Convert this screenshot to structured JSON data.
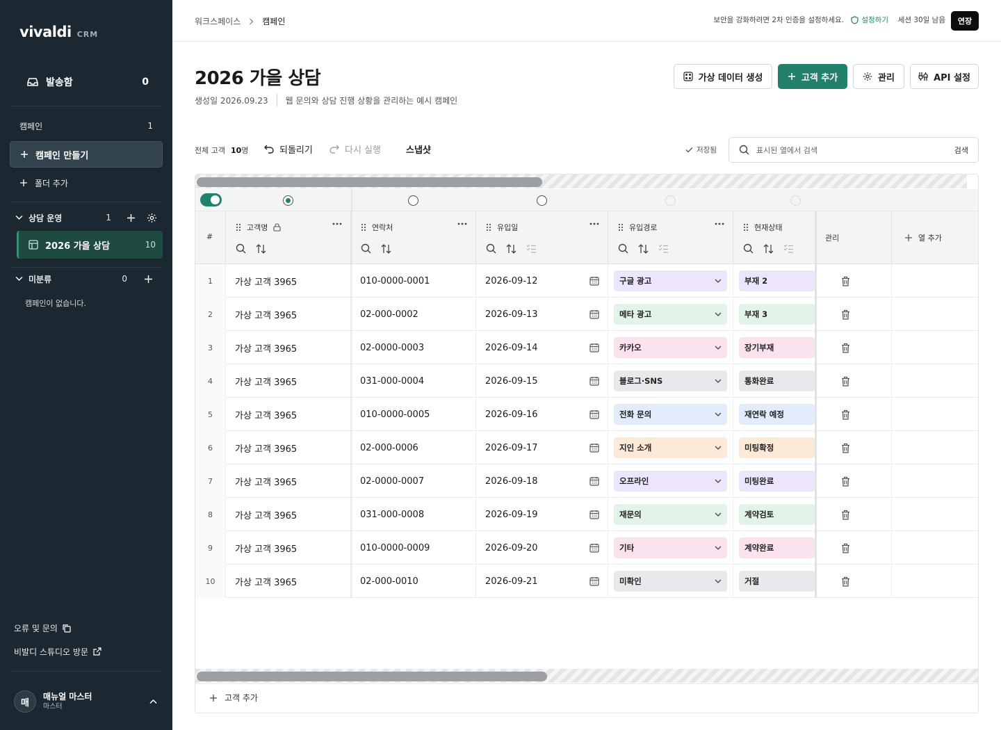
{
  "sidebar": {
    "brand": "vivaldi",
    "brand_sub": "CRM",
    "inbox": {
      "label": "발송함",
      "count": "0"
    },
    "campaigns_header": {
      "label": "캠페인",
      "count": "1"
    },
    "create_campaign": "캠페인 만들기",
    "add_folder": "폴더 추가",
    "groups": [
      {
        "label": "상담 운영",
        "count": "1"
      },
      {
        "label": "미분류",
        "count": "0"
      }
    ],
    "active_campaign": {
      "label": "2026 가을 상담",
      "count": "10"
    },
    "empty_note": "캠페인이 없습니다.",
    "footer_links": [
      "오류 및 문의",
      "비발디 스튜디오 방문"
    ],
    "user": {
      "initial": "매",
      "name": "매뉴얼 마스터",
      "role": "마스터"
    }
  },
  "topbar": {
    "breadcrumbs": [
      "워크스페이스",
      "캠페인"
    ],
    "security_message": "보안을 강화하려면 2차 인증을 설정하세요.",
    "security_action": "설정하기",
    "session": "세션 30일 남음",
    "extend": "연장"
  },
  "page": {
    "title": "2026 가을 상담",
    "created": "생성일 2026.09.23",
    "description": "웹 문의와 상담 진행 상황을 관리하는 예시 캠페인",
    "buttons": {
      "generate": "가상 데이터 생성",
      "add_customer": "고객 추가",
      "manage": "관리",
      "api": "API 설정"
    }
  },
  "toolbar": {
    "total_label": "전체 고객",
    "total_value": "10",
    "total_unit": "명",
    "undo": "되돌리기",
    "redo": "다시 실행",
    "snapshot": "스냅샷",
    "saved": "저장됨",
    "search_placeholder": "표시된 열에서 검색",
    "search_button": "검색"
  },
  "table": {
    "columns": {
      "index": "#",
      "name": "고객명",
      "phone": "연락처",
      "date": "유입일",
      "source": "유입경로",
      "status": "현재상태",
      "manage": "관리",
      "add_column": "열 추가"
    },
    "rows": [
      {
        "n": "1",
        "name": "가상 고객 3965",
        "phone": "010-0000-0001",
        "date": "2026-09-12",
        "source": "구글 광고",
        "status": "부재 2"
      },
      {
        "n": "2",
        "name": "가상 고객 3965",
        "phone": "02-000-0002",
        "date": "2026-09-13",
        "source": "메타 광고",
        "status": "부재 3"
      },
      {
        "n": "3",
        "name": "가상 고객 3965",
        "phone": "02-0000-0003",
        "date": "2026-09-14",
        "source": "카카오",
        "status": "장기부재"
      },
      {
        "n": "4",
        "name": "가상 고객 3965",
        "phone": "031-000-0004",
        "date": "2026-09-15",
        "source": "블로그·SNS",
        "status": "통화완료"
      },
      {
        "n": "5",
        "name": "가상 고객 3965",
        "phone": "010-0000-0005",
        "date": "2026-09-16",
        "source": "전화 문의",
        "status": "재연락 예정"
      },
      {
        "n": "6",
        "name": "가상 고객 3965",
        "phone": "02-000-0006",
        "date": "2026-09-17",
        "source": "지인 소개",
        "status": "미팅확정"
      },
      {
        "n": "7",
        "name": "가상 고객 3965",
        "phone": "02-0000-0007",
        "date": "2026-09-18",
        "source": "오프라인",
        "status": "미팅완료"
      },
      {
        "n": "8",
        "name": "가상 고객 3965",
        "phone": "031-000-0008",
        "date": "2026-09-19",
        "source": "재문의",
        "status": "계약검토"
      },
      {
        "n": "9",
        "name": "가상 고객 3965",
        "phone": "010-0000-0009",
        "date": "2026-09-20",
        "source": "기타",
        "status": "계약완료"
      },
      {
        "n": "10",
        "name": "가상 고객 3965",
        "phone": "02-000-0010",
        "date": "2026-09-21",
        "source": "미확인",
        "status": "거절"
      }
    ],
    "pill_colors": [
      "#ece5fb",
      "#e2f3e8",
      "#fae3ee",
      "#e7e9ec",
      "#e3ecfb",
      "#fde9d8",
      "#ece5fb",
      "#e2f3e8",
      "#fae3ee",
      "#e7e9ec"
    ],
    "add_customer": "고객 추가"
  },
  "colors": {
    "accent": "#23806a",
    "sidebar": "#1b2831"
  }
}
